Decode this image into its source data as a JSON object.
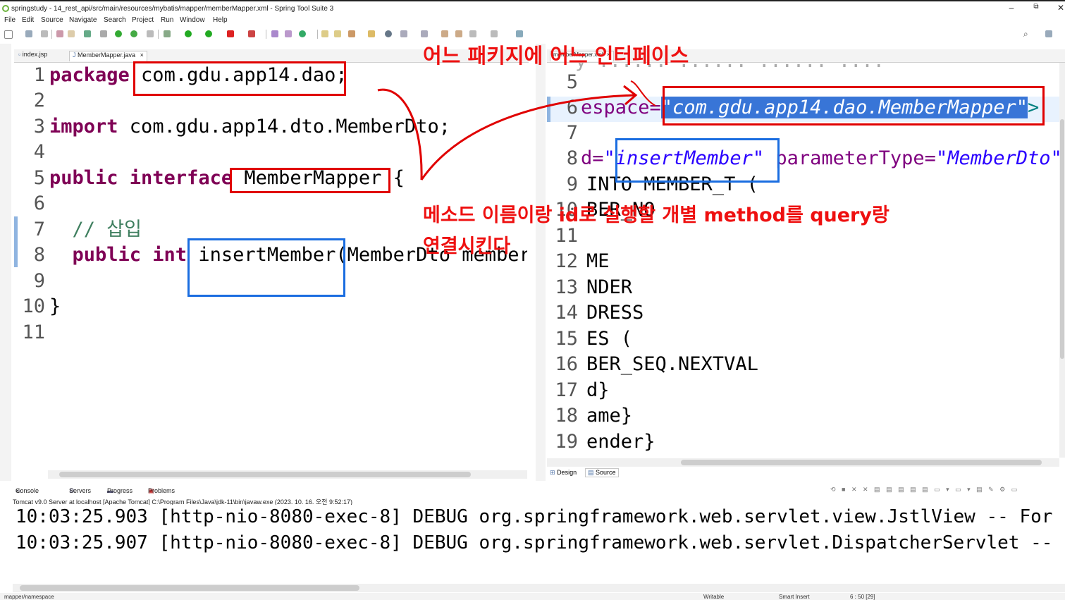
{
  "window": {
    "title": "springstudy - 14_rest_api/src/main/resources/mybatis/mapper/memberMapper.xml - Spring Tool Suite 3",
    "minimize": "–",
    "restore": "⧉",
    "close": "✕"
  },
  "menu": [
    "File",
    "Edit",
    "Source",
    "Navigate",
    "Search",
    "Project",
    "Run",
    "Window",
    "Help"
  ],
  "left_tabs": {
    "tab1": "index.jsp",
    "tab2": "MemberMapper.java",
    "tab2_close": "×"
  },
  "right_tabs": {
    "tab1": "memberMapper.xml",
    "tab1_close": "×"
  },
  "java_editor": {
    "lines": [
      {
        "n": "1",
        "kw": "package",
        "rest": " com.gdu.app14.dao;"
      },
      {
        "n": "2"
      },
      {
        "n": "3",
        "kw": "import",
        "rest": " com.gdu.app14.dto.MemberDto;"
      },
      {
        "n": "4"
      },
      {
        "n": "5",
        "kw": "public interface",
        "rest": " MemberMapper {"
      },
      {
        "n": "6"
      },
      {
        "n": "7",
        "comment": "  // 삽입"
      },
      {
        "n": "8",
        "kw": "  public int",
        "rest": " insertMember(MemberDto memberD"
      },
      {
        "n": "9"
      },
      {
        "n": "10",
        "rest": "}"
      },
      {
        "n": "11"
      }
    ]
  },
  "xml_editor": {
    "top_partial": "y ...... ...... ...... ....",
    "lines": [
      {
        "n": "5",
        "text": ""
      },
      {
        "n": "6",
        "attr": "espace=",
        "value": "\"com.gdu.app14.dao.MemberMapper\"",
        "tail": ">"
      },
      {
        "n": "7",
        "text": ""
      },
      {
        "n": "8",
        "attr": "d=",
        "value": "\"insertMember\"",
        "attr2": " parameterType=",
        "value2": "\"MemberDto\""
      },
      {
        "n": "9",
        "text": "INTO MEMBER_T ("
      },
      {
        "n": "10",
        "text": "BER_NO"
      },
      {
        "n": "11",
        "text": ""
      },
      {
        "n": "12",
        "text": "ME"
      },
      {
        "n": "13",
        "text": "NDER"
      },
      {
        "n": "14",
        "text": "DRESS"
      },
      {
        "n": "15",
        "text": "ES ("
      },
      {
        "n": "16",
        "text": "BER_SEQ.NEXTVAL"
      },
      {
        "n": "17",
        "text": "d}"
      },
      {
        "n": "18",
        "text": "ame}"
      },
      {
        "n": "19",
        "text": "ender}"
      }
    ],
    "bottom_tabs": [
      "Design",
      "Source"
    ]
  },
  "annotations": {
    "top": "어느 패키지에 어느 인터페이스",
    "middle": "메소드 이름이랑 id로 실행할 개별 method를 query랑",
    "middle2": "연결시킨다"
  },
  "console": {
    "tabs": [
      "Console",
      "Servers",
      "Progress",
      "Problems"
    ],
    "console_close": "×",
    "server_line": "Tomcat v9.0 Server at localhost [Apache Tomcat] C:\\Program Files\\Java\\jdk-11\\bin\\javaw.exe  (2023. 10. 16. 오전 9:52:17)",
    "lines": [
      "10:03:25.903 [http-nio-8080-exec-8] DEBUG org.springframework.web.servlet.view.JstlView -- For",
      "10:03:25.907 [http-nio-8080-exec-8] DEBUG org.springframework.web.servlet.DispatcherServlet --"
    ]
  },
  "status": {
    "path": "mapper/namespace",
    "writable": "Writable",
    "insert": "Smart Insert",
    "position": "6 : 50 [29]"
  },
  "colors": {
    "annotation_red": "#e00000",
    "highlight_blue": "#1a6de0",
    "keyword": "#7f0055",
    "string": "#2a00ff"
  }
}
